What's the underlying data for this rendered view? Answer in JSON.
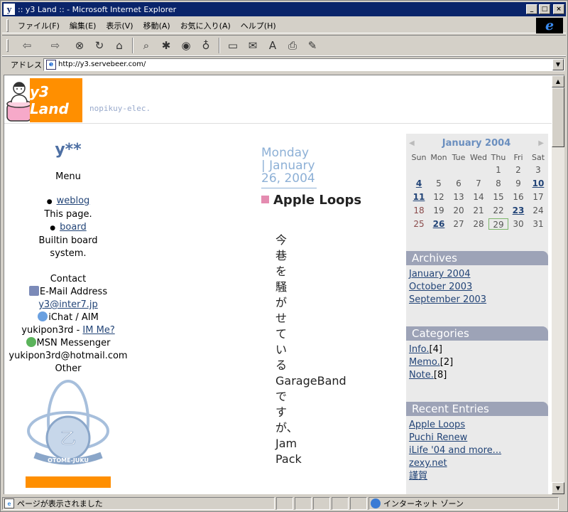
{
  "window": {
    "title": ":: y3 Land :: - Microsoft Internet Explorer",
    "min_label": "_",
    "max_label": "□",
    "close_label": "×"
  },
  "menubar": {
    "items": [
      "ファイル(F)",
      "編集(E)",
      "表示(V)",
      "移動(A)",
      "お気に入り(A)",
      "ヘルプ(H)"
    ]
  },
  "toolbar": {
    "back": "⇦",
    "forward": "⇨",
    "stop": "⊗",
    "refresh": "↻",
    "home": "⌂",
    "search": "⌕",
    "favorites": "✱",
    "history": "◉",
    "channels": "♁",
    "fullscreen": "▭",
    "mail": "✉",
    "font": "A",
    "print": "⎙",
    "edit": "✎"
  },
  "address": {
    "label": "アドレス",
    "url": "http://y3.servebeer.com/"
  },
  "header": {
    "logo_text": "y3 Land",
    "tagline": "nopikuy-elec."
  },
  "left": {
    "site_name": "y**",
    "menu_title": "Menu",
    "links": [
      {
        "label": "weblog",
        "desc": "This page."
      },
      {
        "label": "board",
        "desc": "Builtin board system."
      }
    ],
    "contact_title": "Contact",
    "email_label": "E-Mail Address",
    "email": "y3@inter7.jp",
    "ichat_label": "iChat / AIM",
    "ichat_user": "yukipon3rd",
    "ichat_dash": " - ",
    "ichat_link": "IM Me?",
    "msn_label": "MSN Messenger",
    "msn_user": "yukipon3rd@hotmail.com",
    "other_title": "Other",
    "emblem_text": "OTOME-JUKU"
  },
  "main": {
    "date": "Monday | January 26, 2004",
    "entry_title": "Apple Loops",
    "body_lines": [
      "今",
      "巷",
      "を",
      "騒",
      "が",
      "せ",
      "て",
      "い",
      "る",
      "GarageBand",
      "で",
      "す",
      "が、",
      "Jam",
      "Pack"
    ]
  },
  "calendar": {
    "month": "January 2004",
    "prev": "◀",
    "next": "▶",
    "dow": [
      "Sun",
      "Mon",
      "Tue",
      "Wed",
      "Thu",
      "Fri",
      "Sat"
    ],
    "blank_leading": 4,
    "days": [
      {
        "d": "1"
      },
      {
        "d": "2"
      },
      {
        "d": "3"
      },
      {
        "d": "4",
        "link": true
      },
      {
        "d": "5"
      },
      {
        "d": "6"
      },
      {
        "d": "7"
      },
      {
        "d": "8"
      },
      {
        "d": "9"
      },
      {
        "d": "10",
        "link": true
      },
      {
        "d": "11",
        "link": true
      },
      {
        "d": "12"
      },
      {
        "d": "13"
      },
      {
        "d": "14"
      },
      {
        "d": "15"
      },
      {
        "d": "16"
      },
      {
        "d": "17"
      },
      {
        "d": "18"
      },
      {
        "d": "19"
      },
      {
        "d": "20"
      },
      {
        "d": "21"
      },
      {
        "d": "22"
      },
      {
        "d": "23",
        "link": true
      },
      {
        "d": "24"
      },
      {
        "d": "25"
      },
      {
        "d": "26",
        "link": true
      },
      {
        "d": "27"
      },
      {
        "d": "28"
      },
      {
        "d": "29",
        "today": true
      },
      {
        "d": "30"
      },
      {
        "d": "31"
      }
    ]
  },
  "archives": {
    "title": "Archives",
    "items": [
      "January 2004",
      "October 2003",
      "September 2003"
    ]
  },
  "categories": {
    "title": "Categories",
    "items": [
      {
        "label": "Info.",
        "count": "[4]"
      },
      {
        "label": "Memo.",
        "count": "[2]"
      },
      {
        "label": "Note.",
        "count": "[8]"
      }
    ]
  },
  "recent": {
    "title": "Recent Entries",
    "items": [
      "Apple Loops",
      "Puchi Renew",
      "iLife '04 and more...",
      "zexy.net",
      "謹賀"
    ]
  },
  "status": {
    "message": "ページが表示されました",
    "zone": "インターネット ゾーン"
  }
}
